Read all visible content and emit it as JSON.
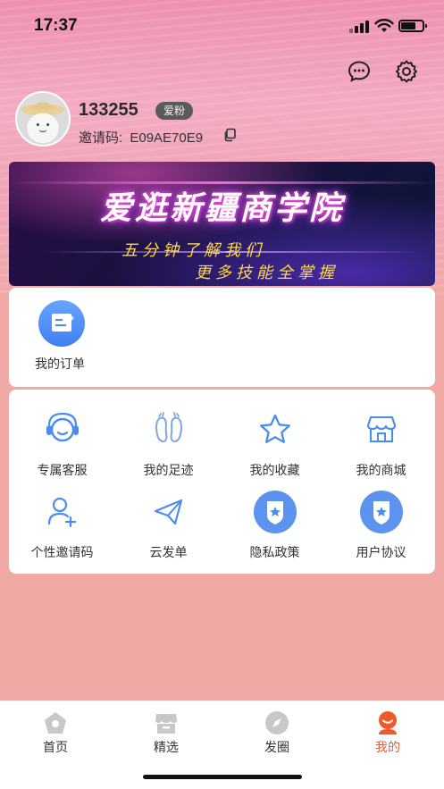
{
  "status_bar": {
    "time": "17:37"
  },
  "profile": {
    "username": "133255",
    "badge": "爱粉",
    "invite_label": "邀请码:",
    "invite_code": "E09AE70E9"
  },
  "banner": {
    "title": "爱逛新疆商学院",
    "subtitle_line1": "五分钟了解我们",
    "subtitle_line2": "更多技能全掌握"
  },
  "orders": {
    "label": "我的订单"
  },
  "tools": [
    {
      "label": "专属客服",
      "icon": "headset-icon"
    },
    {
      "label": "我的足迹",
      "icon": "footprints-icon"
    },
    {
      "label": "我的收藏",
      "icon": "star-icon"
    },
    {
      "label": "我的商城",
      "icon": "shop-icon"
    },
    {
      "label": "个性邀请码",
      "icon": "add-user-icon"
    },
    {
      "label": "云发单",
      "icon": "paper-plane-icon"
    },
    {
      "label": "隐私政策",
      "icon": "shield-star-icon"
    },
    {
      "label": "用户协议",
      "icon": "shield-star-icon"
    }
  ],
  "tabbar": [
    {
      "label": "首页",
      "icon": "home-icon"
    },
    {
      "label": "精选",
      "icon": "store-icon"
    },
    {
      "label": "发圈",
      "icon": "compass-icon"
    },
    {
      "label": "我的",
      "icon": "profile-icon",
      "active": true
    }
  ],
  "colors": {
    "accent": "#ee5a2c",
    "icon_blue": "#4a8df0",
    "page_bg": "#f1a9a6"
  }
}
